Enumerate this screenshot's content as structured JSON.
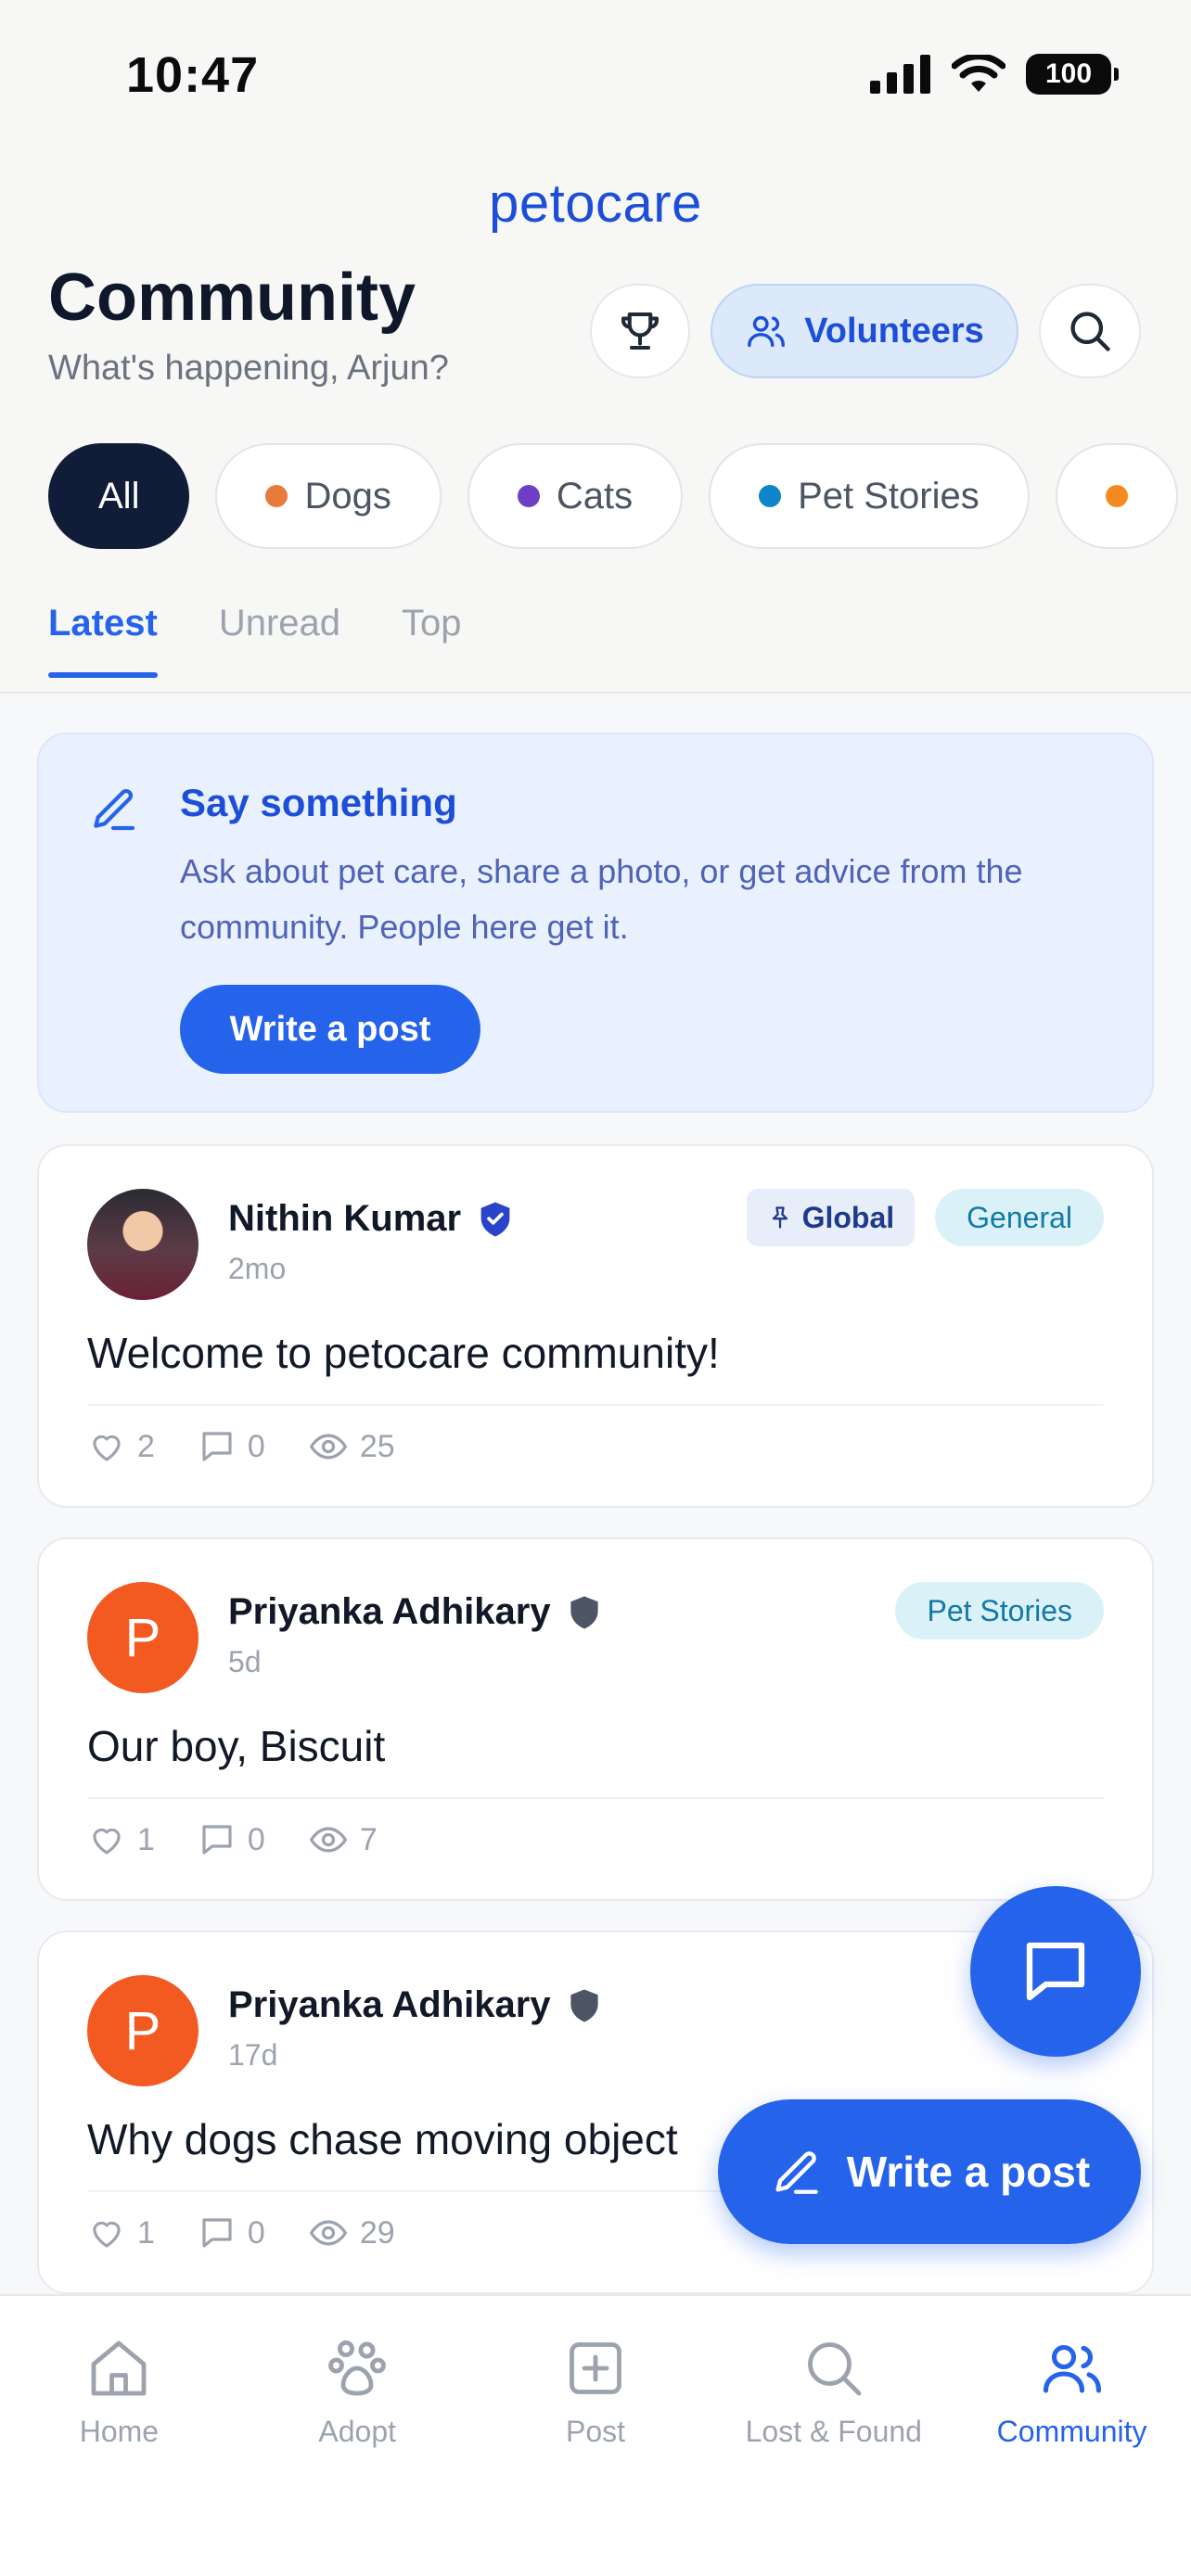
{
  "status_bar": {
    "time": "10:47",
    "battery": "100"
  },
  "header": {
    "logo": "petocare",
    "title": "Community",
    "subtitle": "What's happening, Arjun?",
    "volunteers_label": "Volunteers"
  },
  "chips": [
    {
      "label": "All",
      "dot_color": ""
    },
    {
      "label": "Dogs",
      "dot_color": "#ea7a3c"
    },
    {
      "label": "Cats",
      "dot_color": "#6d3fc4"
    },
    {
      "label": "Pet Stories",
      "dot_color": "#0f86c9"
    }
  ],
  "tabs": [
    "Latest",
    "Unread",
    "Top"
  ],
  "composer": {
    "title": "Say something",
    "description": "Ask about pet care, share a photo, or get advice from the community. People here get it.",
    "button_label": "Write a post"
  },
  "posts": [
    {
      "author": "Nithin Kumar",
      "time": "2mo",
      "text": "Welcome to petocare community!",
      "pin_label": "Global",
      "category": "General",
      "likes": "2",
      "comments": "0",
      "views": "25"
    },
    {
      "author": "Priyanka Adhikary",
      "avatar_letter": "P",
      "time": "5d",
      "text": "Our boy, Biscuit",
      "category": "Pet Stories",
      "likes": "1",
      "comments": "0",
      "views": "7"
    },
    {
      "author": "Priyanka Adhikary",
      "avatar_letter": "P",
      "time": "17d",
      "text": "Why dogs chase moving object",
      "likes": "1",
      "comments": "0",
      "views": "29"
    }
  ],
  "fab": {
    "write_label": "Write a post"
  },
  "bottom_nav": [
    {
      "label": "Home",
      "icon": "home-icon"
    },
    {
      "label": "Adopt",
      "icon": "paw-icon"
    },
    {
      "label": "Post",
      "icon": "plus-square-icon"
    },
    {
      "label": "Lost & Found",
      "icon": "search-icon"
    },
    {
      "label": "Community",
      "icon": "users-icon"
    }
  ],
  "colors": {
    "accent": "#2563eb",
    "dark_chip": "#111c38",
    "avatar_orange": "#f35a22"
  }
}
